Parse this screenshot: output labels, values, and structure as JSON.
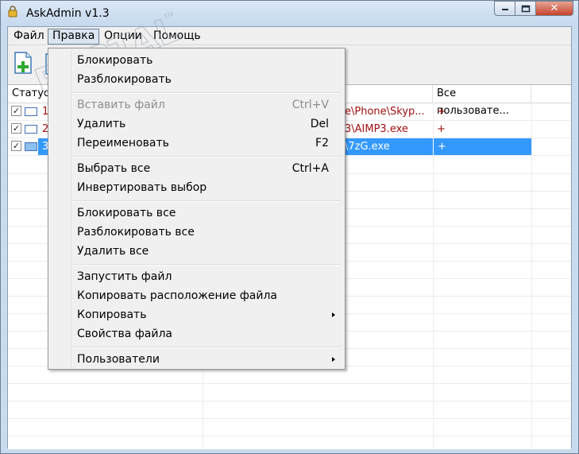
{
  "window": {
    "title": "AskAdmin v1.3",
    "close_glyph": "✕"
  },
  "menubar": [
    "Файл",
    "Правка",
    "Опции",
    "Помощь"
  ],
  "list": {
    "columns": [
      "Статус",
      "",
      "Все пользовате..."
    ],
    "rows": [
      {
        "status_num": "1",
        "path": "e\\Phone\\Skyp...",
        "users": "+",
        "checked": true,
        "selected": false
      },
      {
        "status_num": "2",
        "path": "3\\AIMP3.exe",
        "users": "+",
        "checked": true,
        "selected": false
      },
      {
        "status_num": "3",
        "path": "\\7zG.exe",
        "users": "+",
        "checked": true,
        "selected": true
      }
    ]
  },
  "edit_menu": {
    "items": [
      {
        "label": "Блокировать",
        "shortcut": "",
        "disabled": false,
        "submenu": false
      },
      {
        "label": "Разблокировать",
        "shortcut": "",
        "disabled": false,
        "submenu": false
      },
      {
        "label": "Вставить файл",
        "shortcut": "Ctrl+V",
        "disabled": true,
        "submenu": false
      },
      {
        "label": "Удалить",
        "shortcut": "Del",
        "disabled": false,
        "submenu": false
      },
      {
        "label": "Переименовать",
        "shortcut": "F2",
        "disabled": false,
        "submenu": false
      },
      {
        "label": "Выбрать все",
        "shortcut": "Ctrl+A",
        "disabled": false,
        "submenu": false
      },
      {
        "label": "Инвертировать выбор",
        "shortcut": "",
        "disabled": false,
        "submenu": false
      },
      {
        "label": "Блокировать все",
        "shortcut": "",
        "disabled": false,
        "submenu": false
      },
      {
        "label": "Разблокировать все",
        "shortcut": "",
        "disabled": false,
        "submenu": false
      },
      {
        "label": "Удалить все",
        "shortcut": "",
        "disabled": false,
        "submenu": false
      },
      {
        "label": "Запустить файл",
        "shortcut": "",
        "disabled": false,
        "submenu": false
      },
      {
        "label": "Копировать расположение файла",
        "shortcut": "",
        "disabled": false,
        "submenu": false
      },
      {
        "label": "Копировать",
        "shortcut": "",
        "disabled": false,
        "submenu": true
      },
      {
        "label": "Свойства файла",
        "shortcut": "",
        "disabled": false,
        "submenu": false
      },
      {
        "label": "Пользователи",
        "shortcut": "",
        "disabled": false,
        "submenu": true
      }
    ]
  },
  "watermark": {
    "text": "PORTAL",
    "url": "www.softportal.com",
    "tm": "TM"
  },
  "colors": {
    "selection": "#3399ff",
    "path_text": "#a01010"
  }
}
